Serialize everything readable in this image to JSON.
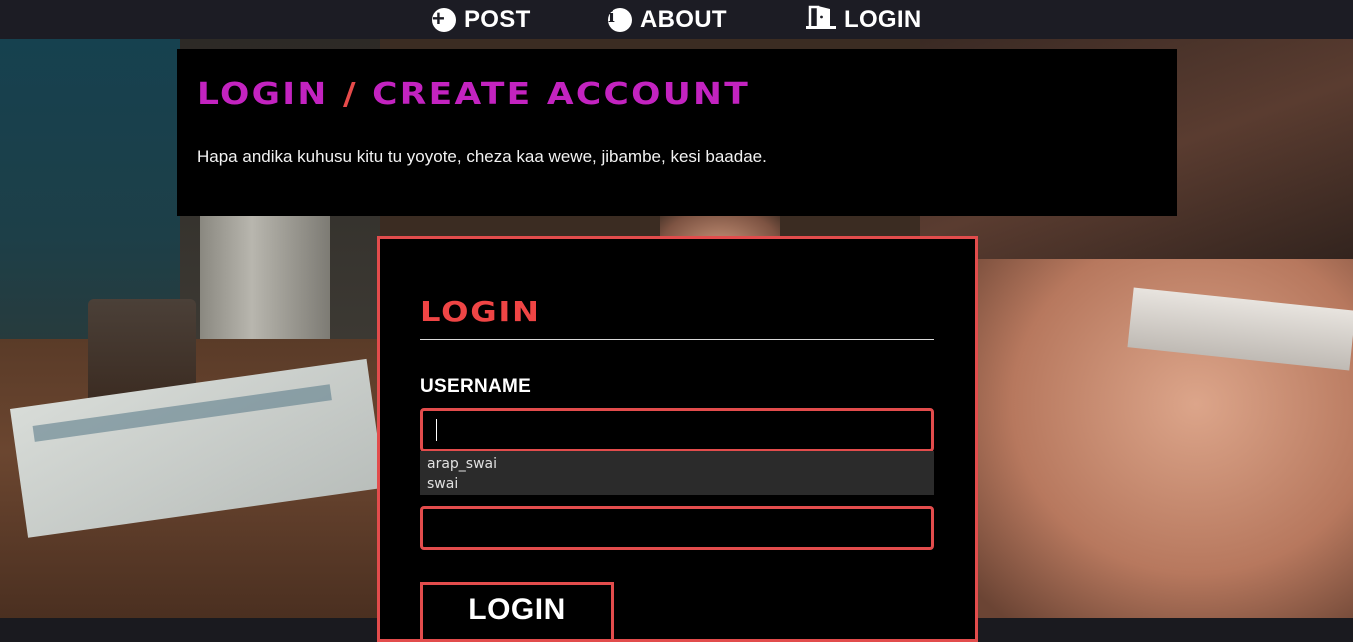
{
  "nav": {
    "items": [
      {
        "label": "POST",
        "icon": "plus-circle-icon"
      },
      {
        "label": "ABOUT",
        "icon": "info-circle-icon"
      },
      {
        "label": "LOGIN",
        "icon": "door-open-icon"
      }
    ]
  },
  "header": {
    "title_part1": "LOGIN",
    "title_sep": "/",
    "title_part2": "CREATE ACCOUNT",
    "description": "Hapa andika kuhusu kitu tu yoyote, cheza kaa wewe, jibambe, kesi baadae."
  },
  "login": {
    "title": "LOGIN",
    "username_label": "USERNAME",
    "username_value": "",
    "password_value": "",
    "autocomplete": [
      "arap_swai",
      "swai"
    ],
    "button_label": "LOGIN"
  },
  "colors": {
    "accent_red": "#e24c4c",
    "title_magenta": "#c323c0",
    "nav_bg": "#1c1c24"
  }
}
